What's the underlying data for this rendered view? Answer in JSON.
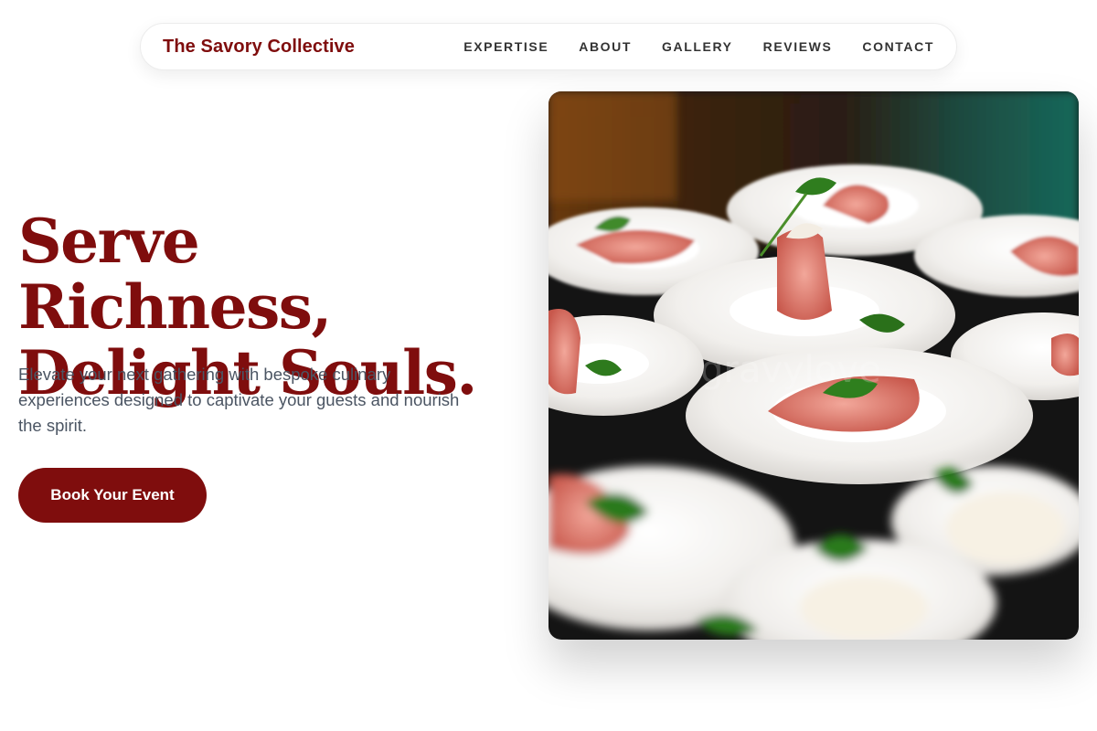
{
  "nav": {
    "brand": "The Savory Collective",
    "links": [
      "EXPERTISE",
      "ABOUT",
      "GALLERY",
      "REVIEWS",
      "CONTACT"
    ]
  },
  "hero": {
    "headline_line1": "Serve Richness,",
    "headline_line2": "Delight Souls.",
    "subtext": "Elevate your next gathering with bespoke culinary experiences designed to captivate your guests and nourish the spirit.",
    "cta_label": "Book Your Event",
    "image_watermark": "gravylove"
  },
  "colors": {
    "brand": "#7f0d0d",
    "body_text": "#4b5563",
    "nav_text": "#333333"
  }
}
